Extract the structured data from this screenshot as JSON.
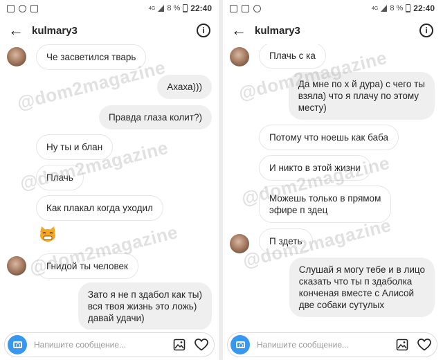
{
  "status_bar": {
    "time": "22:40",
    "battery": "8 %",
    "network": "4G"
  },
  "watermark_text": "@dom2magazine",
  "left": {
    "header": {
      "username": "kulmary3"
    },
    "messages": [
      {
        "side": "in",
        "text": "Че засветился тварь",
        "avatar": true
      },
      {
        "side": "out",
        "text": "Ахаха)))"
      },
      {
        "side": "out",
        "text": "Правда глаза колит?)"
      },
      {
        "side": "in",
        "text": "Ну ты и   блан"
      },
      {
        "side": "in",
        "text": "Плачь"
      },
      {
        "side": "in",
        "text": "Как плакал когда уходил"
      },
      {
        "side": "in",
        "emoji": "cat-emoji"
      },
      {
        "side": "in",
        "text": "Гнидой ты человек",
        "avatar": true
      },
      {
        "side": "out",
        "lines": [
          "Зато я не п  здабол как ты)",
          "вся твоя жизнь это ложь)",
          "давай удачи)"
        ]
      }
    ],
    "composer": {
      "placeholder": "Напишите сообщение..."
    }
  },
  "right": {
    "header": {
      "username": "kulmary3"
    },
    "messages": [
      {
        "side": "in",
        "text": "Плачь с  ка",
        "avatar": true
      },
      {
        "side": "out",
        "lines": [
          "Да мне по х  й дура) с чего ты",
          "взяла) что я плачу по этому",
          "месту)"
        ]
      },
      {
        "side": "in",
        "text": "Потому что ноешь как баба"
      },
      {
        "side": "in",
        "text": "И никто в этой жизни"
      },
      {
        "side": "in",
        "lines": [
          "Можешь только в прямом",
          "эфире п  здец"
        ]
      },
      {
        "side": "in",
        "text": "П  здеть",
        "avatar": true
      },
      {
        "side": "out",
        "lines": [
          "Слушай я могу тебе и в лицо",
          "сказать что ты п  здаболка",
          "конченая вместе с Алисой",
          "две собаки сутулых"
        ]
      }
    ],
    "composer": {
      "placeholder": "Напишите сообщение..."
    }
  }
}
